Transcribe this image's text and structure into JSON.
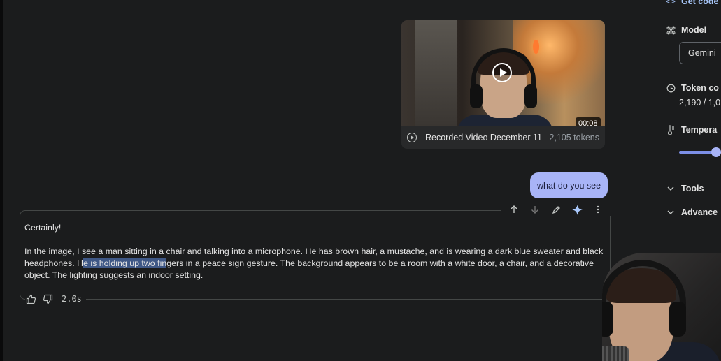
{
  "video": {
    "duration": "00:08",
    "name": "Recorded Video December 11, ...",
    "tokens": "2,105 tokens"
  },
  "user_message": "what do you see",
  "response": {
    "intro": "Certainly!",
    "body_before_highlight": "In the image, I see a man sitting in a chair and talking into a microphone. He has brown hair, a mustache, and is wearing a dark blue sweater and black headphones. H",
    "body_highlight": "e is holding up two fin",
    "body_after_highlight": "gers in a peace sign gesture. The background appears to be a room with a white door, a chair, and a decorative object. The lighting suggests an indoor setting.",
    "time": "2.0s"
  },
  "panel": {
    "get_code": "Get code",
    "model_label": "Model",
    "model_value": "Gemini",
    "token_label": "Token co",
    "token_value": "2,190 / 1,0",
    "temperature_label": "Tempera",
    "tools_label": "Tools",
    "advanced_label": "Advance",
    "temperature_level": 1.0
  },
  "colors": {
    "accent": "#a8b4f7",
    "highlight": "#3f5886",
    "link": "#a8c7fa"
  }
}
